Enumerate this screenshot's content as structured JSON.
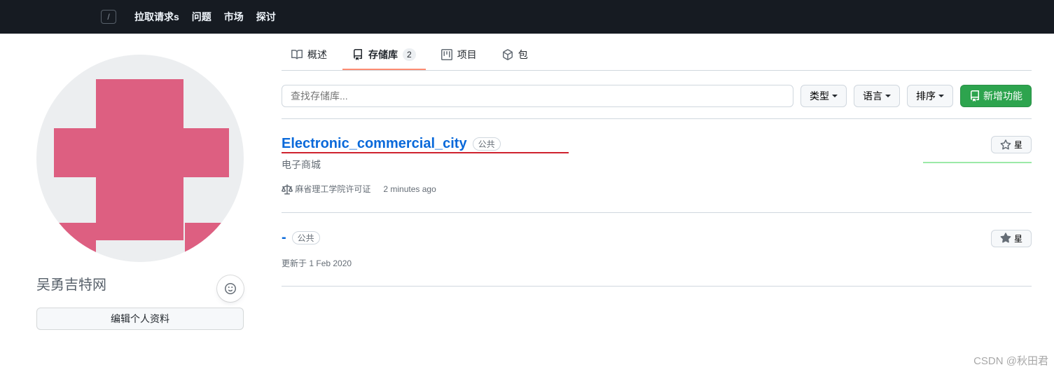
{
  "header": {
    "slash_key": "/",
    "nav": [
      "拉取请求s",
      "问题",
      "市场",
      "探讨"
    ]
  },
  "sidebar": {
    "username": "吴勇吉特网",
    "edit_profile_label": "编辑个人资料"
  },
  "tabs": {
    "overview": "概述",
    "repos": "存储库",
    "repos_count": "2",
    "projects": "项目",
    "packages": "包"
  },
  "controls": {
    "search_placeholder": "查找存储库...",
    "type_label": "类型",
    "language_label": "语言",
    "sort_label": "排序",
    "new_label": "新增功能"
  },
  "repos": [
    {
      "name": "Electronic_commercial_city",
      "visibility": "公共",
      "description": "电子商城",
      "license": "麻省理工学院许可证",
      "updated": "2 minutes ago",
      "star_label": "星"
    },
    {
      "name": "-",
      "visibility": "公共",
      "updated_prefix": "更新于",
      "updated": "1 Feb 2020",
      "star_label": "星"
    }
  ],
  "watermark": "CSDN @秋田君"
}
